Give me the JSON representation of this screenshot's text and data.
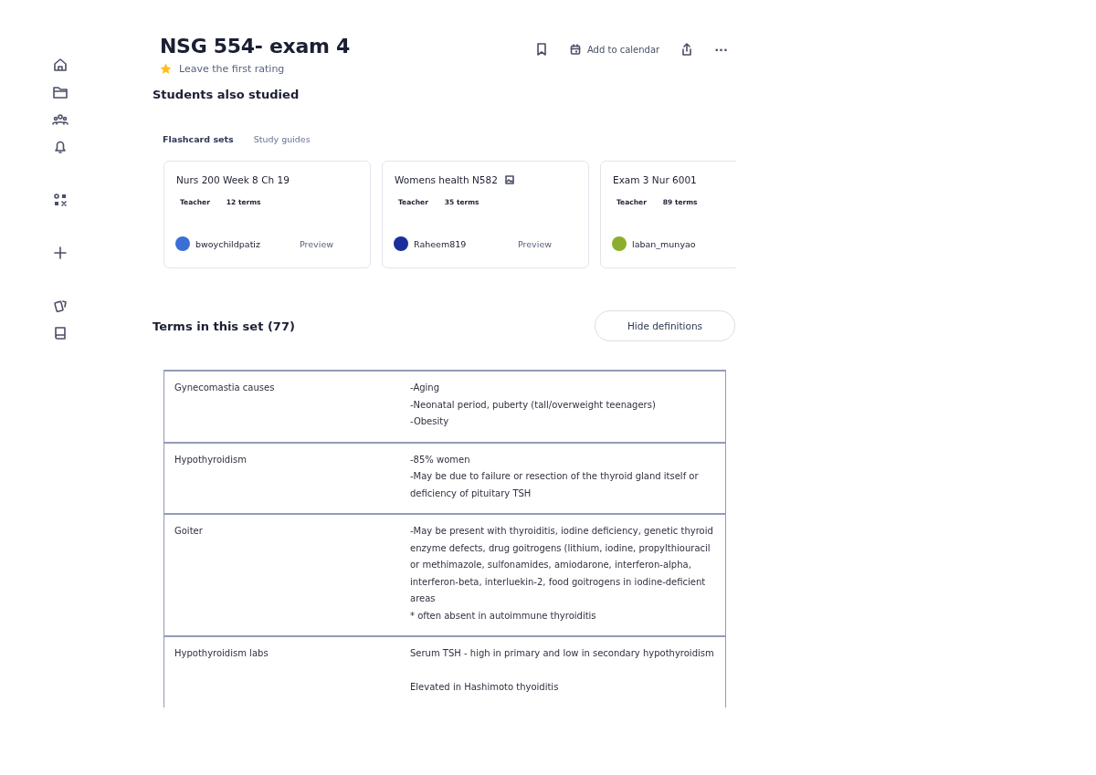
{
  "sidebar": {
    "items": [
      {
        "kind": "home"
      },
      {
        "kind": "folder"
      },
      {
        "kind": "people"
      },
      {
        "kind": "bell"
      },
      {
        "kind": "gap"
      },
      {
        "kind": "apps"
      },
      {
        "kind": "gap"
      },
      {
        "kind": "plus"
      },
      {
        "kind": "gap"
      },
      {
        "kind": "cards"
      },
      {
        "kind": "book"
      }
    ]
  },
  "header": {
    "title": "NSG 554- exam 4",
    "rating_prompt": "Leave the first rating",
    "actions": [
      {
        "kind": "save"
      },
      {
        "kind": "calendar",
        "label": "Add to calendar"
      },
      {
        "kind": "share"
      },
      {
        "kind": "more",
        "label": "···"
      }
    ]
  },
  "students_also_studied": {
    "heading": "Students also studied",
    "tabs": [
      {
        "label": "Flashcard sets",
        "selected": true
      },
      {
        "label": "Study guides",
        "selected": false
      }
    ],
    "cards": [
      {
        "title": "Nurs 200 Week 8 Ch 19",
        "image_icon": false,
        "role": "Teacher",
        "count": "12 terms",
        "author": "bwoychildpatiz",
        "color": "#3b6fd8",
        "preview": "Preview"
      },
      {
        "title": "Womens health N582",
        "image_icon": true,
        "role": "Teacher",
        "count": "35 terms",
        "author": "Raheem819",
        "color": "#1b2f9a",
        "preview": "Preview"
      },
      {
        "title": "Exam 3 Nur 6001",
        "image_icon": false,
        "role": "Teacher",
        "count": "89 terms",
        "author": "laban_munyao",
        "color": "#8cae2c"
      }
    ]
  },
  "terms": {
    "heading": "Terms in this set (77)",
    "toggle_button": "Hide definitions",
    "rows": [
      {
        "term": "Gynecomastia causes",
        "definition": "-Aging\n-Neonatal period, puberty (tall/overweight teenagers)\n-Obesity"
      },
      {
        "term": "Hypothyroidism",
        "definition": "-85% women\n-May be due to failure or resection of the thyroid gland itself or deficiency of pituitary TSH"
      },
      {
        "term": "Goiter",
        "definition": "-May be present with thyroiditis, iodine deficiency, genetic thyroid enzyme defects, drug goitrogens (lithium, iodine, propylthiouracil or methimazole, sulfonamides, amiodarone, interferon-alpha, interferon-beta, interluekin-2, food goitrogens in iodine-deficient areas\n* often absent in autoimmune thyroiditis"
      },
      {
        "term": "Hypothyroidism labs",
        "definition": "Serum TSH - high in primary and low in secondary hypothyroidism\n\nElevated in Hashimoto thyoiditis"
      }
    ]
  }
}
